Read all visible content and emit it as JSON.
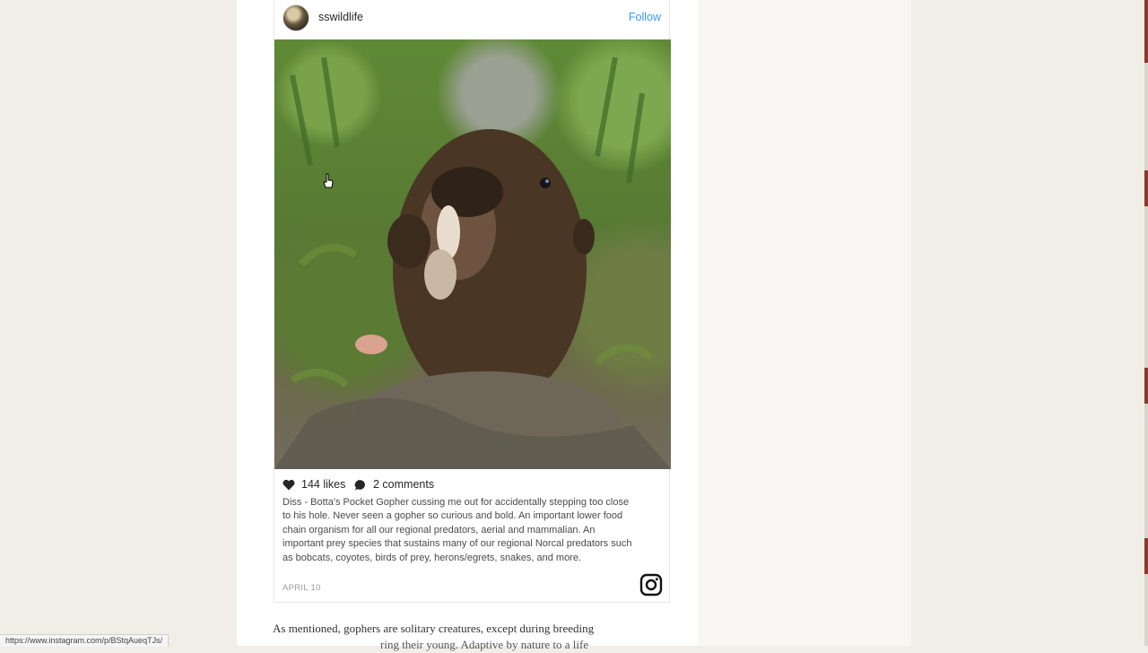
{
  "post": {
    "username": "sswildlife",
    "follow_label": "Follow",
    "likes": "144 likes",
    "comments": "2 comments",
    "caption": "Diss - Botta's Pocket Gopher cussing me out for accidentally stepping too close to his hole. Never seen a gopher so curious and bold. An important lower food chain organism for all our regional predators, aerial and mammalian. An important prey species that sustains many of our regional Norcal predators such as bobcats, coyotes, birds of prey, herons/egrets, snakes, and more.",
    "date": "APRIL 10"
  },
  "article": {
    "line1": "As mentioned, gophers are solitary creatures, except during breeding",
    "line2": "ring their young. Adaptive by nature to a life"
  },
  "status_bar": {
    "url": "https://www.instagram.com/p/BStqAueqTJs/"
  },
  "colors": {
    "link_blue": "#3897f0",
    "page_background": "#f1ede7"
  },
  "icons": {
    "avatar": "avatar",
    "like": "heart-icon",
    "comment": "comment-icon",
    "brand": "instagram-icon",
    "pointer": "hand-cursor-icon"
  }
}
